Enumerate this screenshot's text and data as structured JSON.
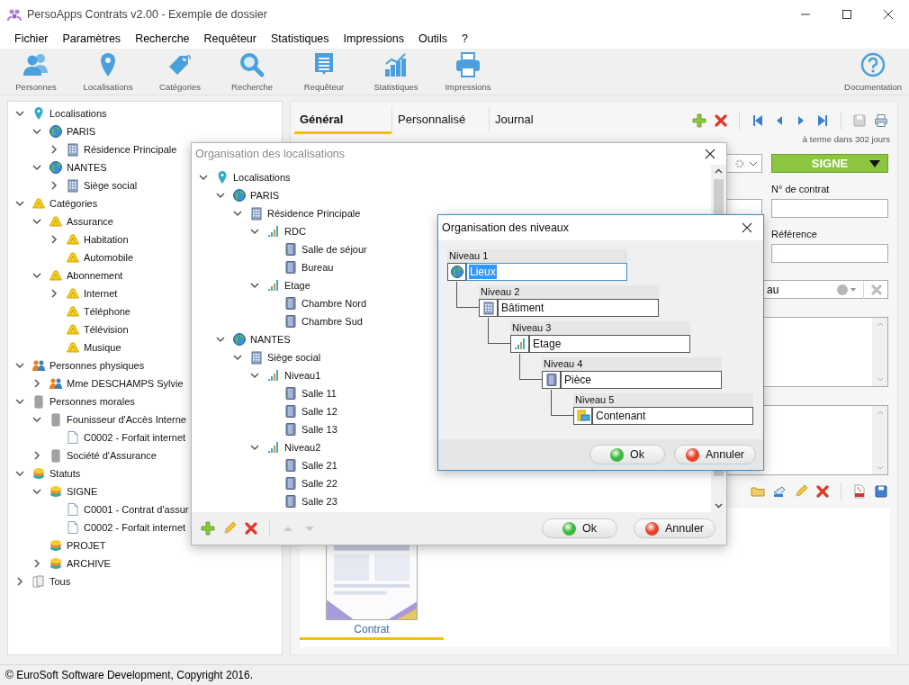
{
  "window": {
    "title": "PersoApps Contrats v2.00 - Exemple de dossier"
  },
  "menu": [
    "Fichier",
    "Paramètres",
    "Recherche",
    "Requêteur",
    "Statistiques",
    "Impressions",
    "Outils",
    "?"
  ],
  "toolbar": {
    "items": [
      {
        "label": "Personnes",
        "kind": "people"
      },
      {
        "label": "Localisations",
        "kind": "pin"
      },
      {
        "label": "Catégories",
        "kind": "tag"
      },
      {
        "label": "Recherche",
        "kind": "search"
      },
      {
        "label": "Requêteur",
        "kind": "list"
      },
      {
        "label": "Statistiques",
        "kind": "chart"
      },
      {
        "label": "Impressions",
        "kind": "printer"
      }
    ],
    "help": {
      "label": "Documentation",
      "kind": "help"
    }
  },
  "sidebar_tree": [
    {
      "label": "Localisations",
      "kind": "pin",
      "expanded": true,
      "children": [
        {
          "label": "PARIS",
          "kind": "globe",
          "expanded": true,
          "children": [
            {
              "label": "Résidence Principale",
              "kind": "building",
              "expanded": false
            }
          ]
        },
        {
          "label": "NANTES",
          "kind": "globe",
          "expanded": true,
          "children": [
            {
              "label": "Siège social",
              "kind": "building",
              "expanded": false
            }
          ]
        }
      ]
    },
    {
      "label": "Catégories",
      "kind": "tag",
      "expanded": true,
      "children": [
        {
          "label": "Assurance",
          "kind": "tag",
          "expanded": true,
          "children": [
            {
              "label": "Habitation",
              "kind": "tag",
              "expanded": false
            },
            {
              "label": "Automobile",
              "kind": "tag"
            }
          ]
        },
        {
          "label": "Abonnement",
          "kind": "tag",
          "expanded": true,
          "children": [
            {
              "label": "Internet",
              "kind": "tag",
              "expanded": false
            },
            {
              "label": "Téléphone",
              "kind": "tag"
            },
            {
              "label": "Télévision",
              "kind": "tag"
            },
            {
              "label": "Musique",
              "kind": "tag"
            }
          ]
        }
      ]
    },
    {
      "label": "Personnes physiques",
      "kind": "people",
      "expanded": true,
      "children": [
        {
          "label": "Mme DESCHAMPS Sylvie",
          "kind": "people",
          "expanded": false
        }
      ]
    },
    {
      "label": "Personnes morales",
      "kind": "company",
      "expanded": true,
      "children": [
        {
          "label": "Founisseur d'Accès Interne",
          "kind": "company",
          "expanded": true,
          "children": [
            {
              "label": "C0002 - Forfait internet",
              "kind": "doc"
            }
          ]
        },
        {
          "label": "Société d'Assurance",
          "kind": "company",
          "expanded": false
        }
      ]
    },
    {
      "label": "Statuts",
      "kind": "status",
      "expanded": true,
      "children": [
        {
          "label": "SIGNE",
          "kind": "status",
          "expanded": true,
          "children": [
            {
              "label": "C0001 - Contrat d'assur",
              "kind": "doc"
            },
            {
              "label": "C0002 - Forfait internet",
              "kind": "doc"
            }
          ]
        },
        {
          "label": "PROJET",
          "kind": "status"
        },
        {
          "label": "ARCHIVE",
          "kind": "status",
          "expanded": false
        }
      ]
    },
    {
      "label": "Tous",
      "kind": "pages",
      "expanded": false
    }
  ],
  "detail": {
    "tabs": [
      {
        "label": "Général",
        "selected": true
      },
      {
        "label": "Personnalisé",
        "selected": false
      },
      {
        "label": "Journal",
        "selected": false
      }
    ],
    "save_disabled": true,
    "due_note": "à terme dans 302 jours",
    "status": "SIGNE",
    "contract_number_label": "N° de contrat",
    "reference_label": "Référence",
    "combo_value": "au",
    "document": {
      "label": "Contrat",
      "selected": true
    }
  },
  "locations_dialog": {
    "title": "Organisation des localisations",
    "move_disabled": true,
    "ok": "Ok",
    "cancel": "Annuler",
    "tree": [
      {
        "label": "Localisations",
        "kind": "pin",
        "expanded": true,
        "children": [
          {
            "label": "PARIS",
            "kind": "globe",
            "expanded": true,
            "children": [
              {
                "label": "Résidence Principale",
                "kind": "building",
                "expanded": true,
                "children": [
                  {
                    "label": "RDC",
                    "kind": "levels",
                    "expanded": true,
                    "children": [
                      {
                        "label": "Salle de séjour",
                        "kind": "room"
                      },
                      {
                        "label": "Bureau",
                        "kind": "room"
                      }
                    ]
                  },
                  {
                    "label": "Etage",
                    "kind": "levels",
                    "expanded": true,
                    "children": [
                      {
                        "label": "Chambre Nord",
                        "kind": "room"
                      },
                      {
                        "label": "Chambre Sud",
                        "kind": "room"
                      }
                    ]
                  }
                ]
              }
            ]
          },
          {
            "label": "NANTES",
            "kind": "globe",
            "expanded": true,
            "children": [
              {
                "label": "Siège social",
                "kind": "building",
                "expanded": true,
                "children": [
                  {
                    "label": "Niveau1",
                    "kind": "levels",
                    "expanded": true,
                    "children": [
                      {
                        "label": "Salle 11",
                        "kind": "room"
                      },
                      {
                        "label": "Salle 12",
                        "kind": "room"
                      },
                      {
                        "label": "Salle 13",
                        "kind": "room"
                      }
                    ]
                  },
                  {
                    "label": "Niveau2",
                    "kind": "levels",
                    "expanded": true,
                    "children": [
                      {
                        "label": "Salle 21",
                        "kind": "room"
                      },
                      {
                        "label": "Salle 22",
                        "kind": "room"
                      },
                      {
                        "label": "Salle 23",
                        "kind": "room"
                      }
                    ]
                  }
                ]
              }
            ]
          }
        ]
      }
    ]
  },
  "levels_dialog": {
    "title": "Organisation des niveaux",
    "ok": "Ok",
    "cancel": "Annuler",
    "levels": [
      {
        "label": "Niveau 1",
        "kind": "globe",
        "value": "Lieux",
        "text_selected": true
      },
      {
        "label": "Niveau 2",
        "kind": "building",
        "value": "Bâtiment",
        "text_selected": false
      },
      {
        "label": "Niveau 3",
        "kind": "levels",
        "value": "Etage",
        "text_selected": false
      },
      {
        "label": "Niveau 4",
        "kind": "room",
        "value": "Pièce",
        "text_selected": false
      },
      {
        "label": "Niveau 5",
        "kind": "container",
        "value": "Contenant",
        "text_selected": false
      }
    ]
  },
  "status_bar": "© EuroSoft Software Development, Copyright 2016."
}
